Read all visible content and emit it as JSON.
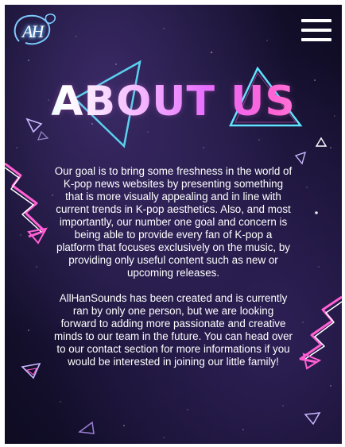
{
  "header": {
    "logo_text": "AH",
    "menu_icon": "hamburger-menu-icon"
  },
  "main": {
    "title": "ABOUT US",
    "paragraphs": [
      "Our goal is to bring some freshness in the world of K-pop news websites by presenting something that is more visually appealing and in line with current trends in K-pop aesthetics. Also, and most importantly, our number one goal and concern is being able to provide every fan of K-pop a platform that focuses exclusively on the music, by providing only useful content such as new or upcoming releases.",
      "AllHanSounds has been created and is currently ran by only one person, but we are looking forward to adding more passionate and creative minds to our team in the future. You can head over to our contact section for more informations if you would be interested in joining our little family!"
    ]
  },
  "colors": {
    "background": "#1a1538",
    "neon_cyan": "#5fe3ff",
    "neon_pink": "#ff5fd2",
    "text": "#ffffff"
  }
}
